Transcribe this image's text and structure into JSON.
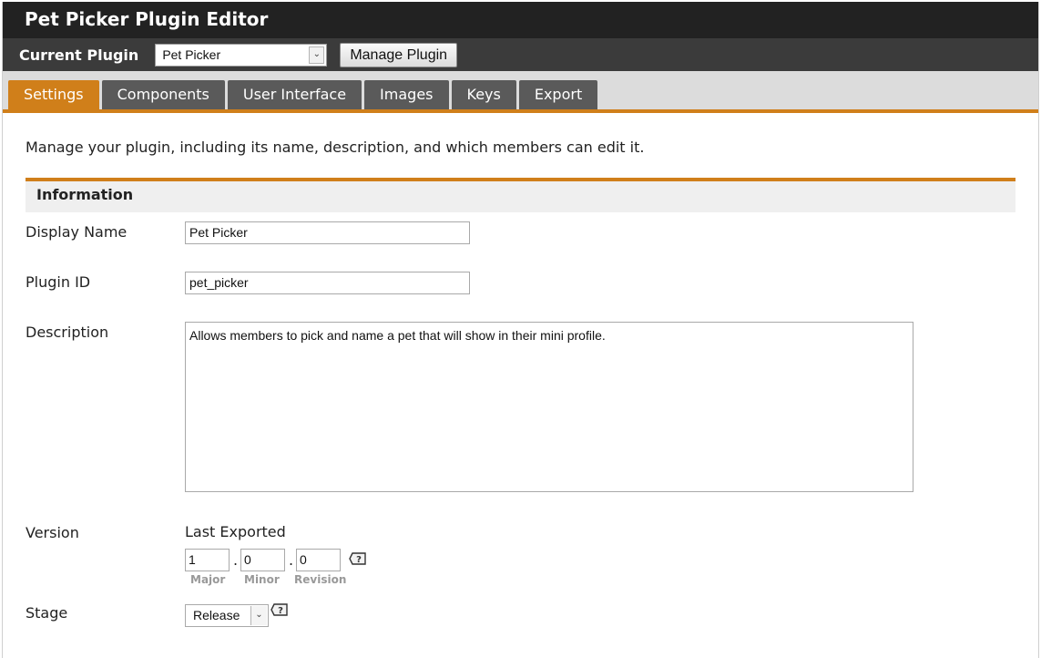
{
  "window": {
    "title": "Pet Picker Plugin Editor"
  },
  "plugin_bar": {
    "label": "Current Plugin",
    "selected": "Pet Picker",
    "manage_label": "Manage Plugin"
  },
  "tabs": [
    {
      "label": "Settings",
      "active": true
    },
    {
      "label": "Components"
    },
    {
      "label": "User Interface"
    },
    {
      "label": "Images"
    },
    {
      "label": "Keys"
    },
    {
      "label": "Export"
    }
  ],
  "intro": "Manage your plugin, including its name, description, and which members can edit it.",
  "section": {
    "title": "Information"
  },
  "fields": {
    "display_name": {
      "label": "Display Name",
      "value": "Pet Picker"
    },
    "plugin_id": {
      "label": "Plugin ID",
      "value": "pet_picker"
    },
    "description": {
      "label": "Description",
      "value": "Allows members to pick and name a pet that will show in their mini profile."
    },
    "version": {
      "label": "Version",
      "sublabel": "Last Exported",
      "major": "1",
      "minor": "0",
      "revision": "0",
      "major_label": "Major",
      "minor_label": "Minor",
      "revision_label": "Revision"
    },
    "stage": {
      "label": "Stage",
      "value": "Release"
    }
  },
  "colors": {
    "accent": "#d07f1a",
    "titlebar": "#222222",
    "tab": "#5a5a5a"
  },
  "icons": {
    "help": "help-icon",
    "dropdown": "chevron-down-icon"
  }
}
